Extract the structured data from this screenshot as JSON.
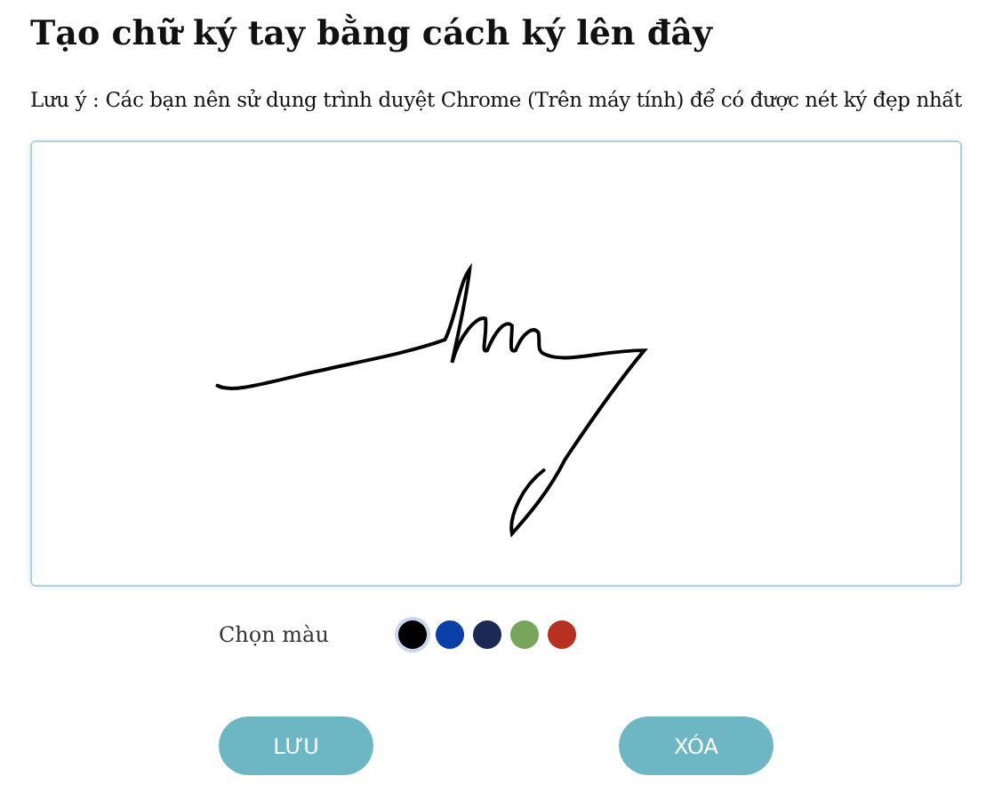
{
  "title": "Tạo chữ ký tay bằng cách ký lên đây",
  "note": "Lưu ý : Các bạn nên sử dụng trình duyệt Chrome (Trên máy tính) để có được nét ký đẹp nhất",
  "color_picker": {
    "label": "Chọn màu",
    "colors": [
      {
        "color": "#000000",
        "selected": true
      },
      {
        "color": "#0a3fa8",
        "selected": false
      },
      {
        "color": "#1a2a55",
        "selected": false
      },
      {
        "color": "#77a65a",
        "selected": false
      },
      {
        "color": "#b8301f",
        "selected": false
      }
    ]
  },
  "buttons": [
    {
      "label": "LƯU"
    },
    {
      "label": "XÓA"
    }
  ]
}
